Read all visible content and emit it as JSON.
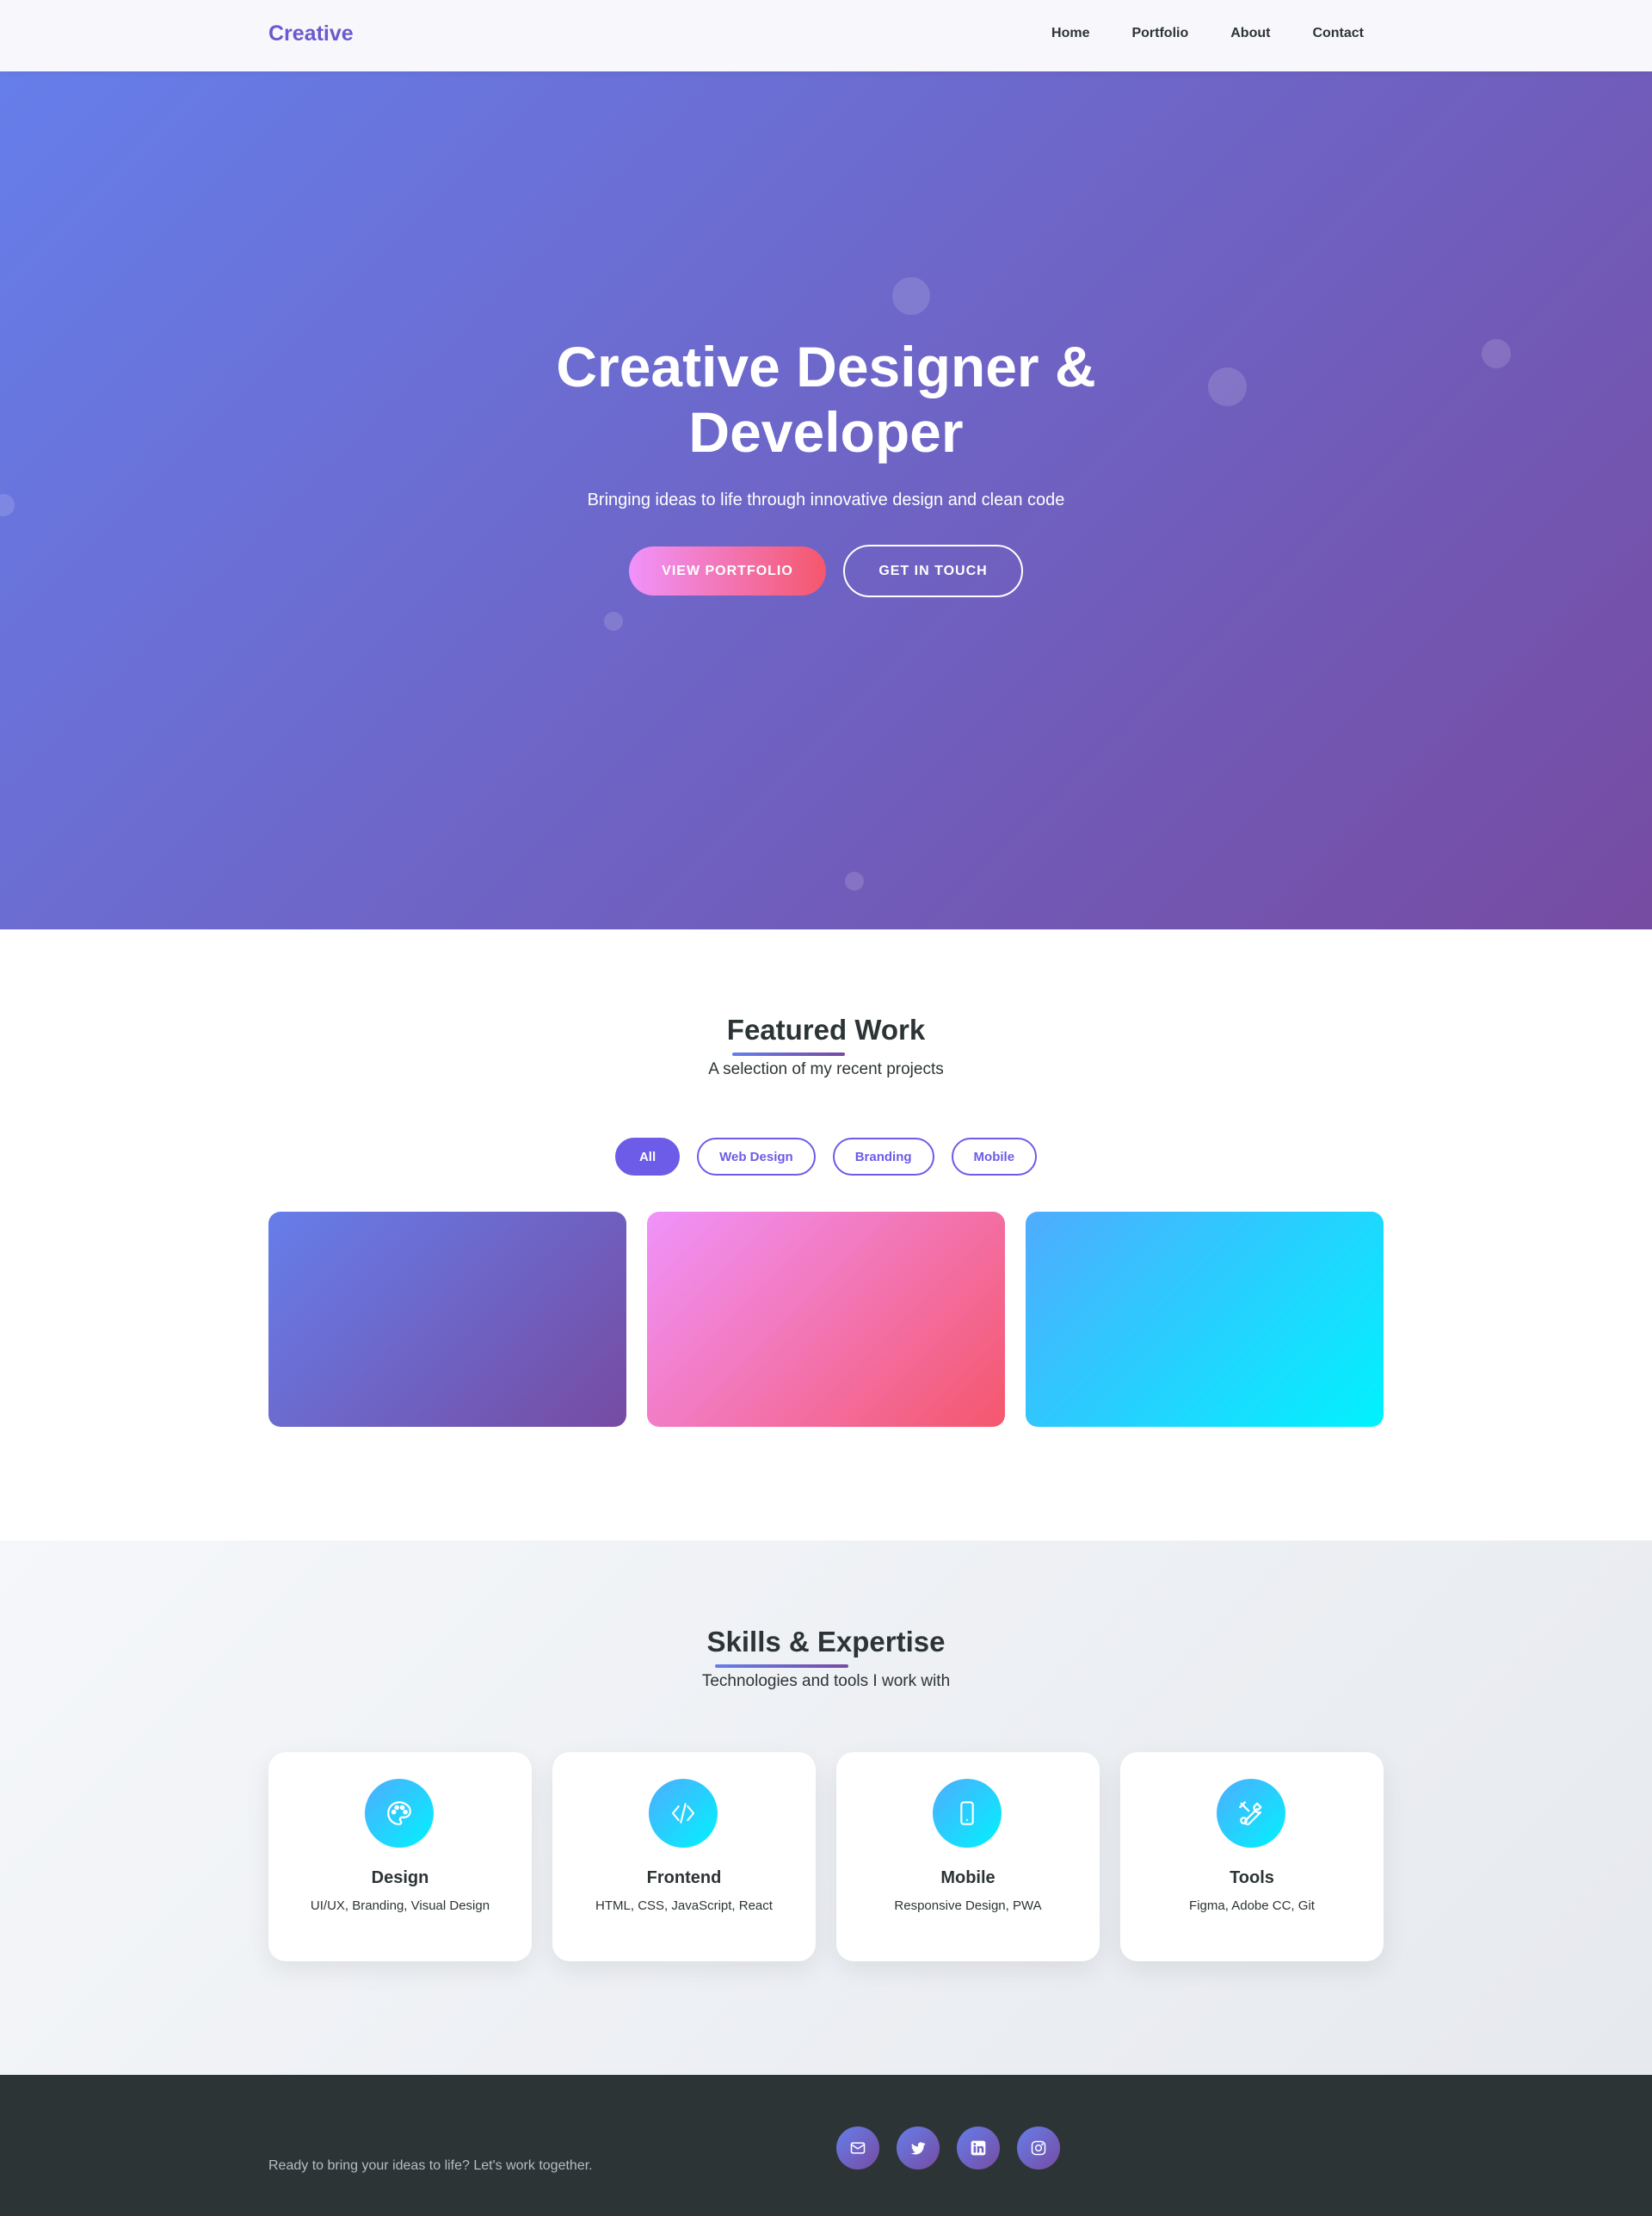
{
  "nav": {
    "brand": "Creative",
    "links": [
      "Home",
      "Portfolio",
      "About",
      "Contact"
    ]
  },
  "hero": {
    "title_line1": "Creative Designer &",
    "title_line2": "Developer",
    "subtitle": "Bringing ideas to life through innovative design and clean code",
    "primary_button": "VIEW PORTFOLIO",
    "secondary_button": "GET IN TOUCH"
  },
  "featured": {
    "title": "Featured Work",
    "subtitle": "A selection of my recent projects",
    "filters": [
      "All",
      "Web Design",
      "Branding",
      "Mobile"
    ],
    "active_filter": "All"
  },
  "skills": {
    "title": "Skills & Expertise",
    "subtitle": "Technologies and tools I work with",
    "items": [
      {
        "icon": "palette-icon",
        "name": "Design",
        "desc": "UI/UX, Branding, Visual Design"
      },
      {
        "icon": "code-icon",
        "name": "Frontend",
        "desc": "HTML, CSS, JavaScript, React"
      },
      {
        "icon": "mobile-icon",
        "name": "Mobile",
        "desc": "Responsive Design, PWA"
      },
      {
        "icon": "tools-icon",
        "name": "Tools",
        "desc": "Figma, Adobe CC, Git"
      }
    ]
  },
  "footer": {
    "tagline": "Ready to bring your ideas to life? Let's work together.",
    "socials": [
      "email-icon",
      "twitter-icon",
      "linkedin-icon",
      "instagram-icon"
    ]
  },
  "colors": {
    "accent": "#6c5ce7",
    "hero_gradient_start": "#667eea",
    "hero_gradient_end": "#764ba2",
    "footer_bg": "#2d3436"
  }
}
